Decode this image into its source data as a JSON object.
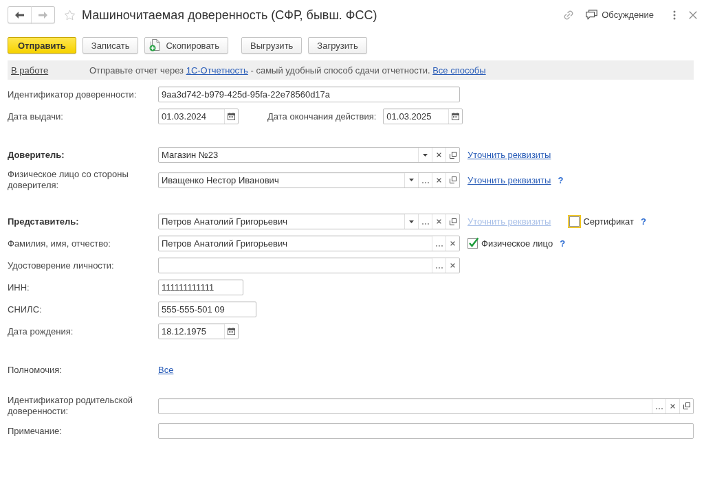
{
  "header": {
    "navigation": {
      "back": {
        "disabled": false
      },
      "forward": {
        "disabled": true
      }
    },
    "favorite": false,
    "title": "Машиночитаемая доверенность (СФР, бывш. ФСС)",
    "discussion": "Обсуждение"
  },
  "toolbar": {
    "groups": [
      [
        {
          "kind": "primary",
          "label": "Отправить"
        },
        {
          "kind": "plain",
          "label": "Записать"
        },
        {
          "kind": "copy",
          "label": "Скопировать"
        }
      ],
      [
        {
          "kind": "plain",
          "label": "Выгрузить"
        },
        {
          "kind": "plain",
          "label": "Загрузить"
        }
      ]
    ]
  },
  "info_bar": {
    "status": "В работе",
    "message": [
      {
        "kind": "text",
        "text": "Отправьте отчет через "
      },
      {
        "kind": "link",
        "text": "1С-Отчетность"
      },
      {
        "kind": "text",
        "text": " - самый удобный способ сдачи отчетности. "
      },
      {
        "kind": "link",
        "text": "Все способы"
      }
    ]
  },
  "form": {
    "sections": [
      {
        "rows": [
          {
            "kind": "text",
            "label": "Идентификатор доверенности:",
            "label_bold": false,
            "value": "9aa3d742-b979-425d-95fa-22e78560d17a"
          },
          {
            "kind": "date_range",
            "label": "Дата выдачи:",
            "label_bold": false,
            "value": "01.03.2024",
            "end_label": "Дата окончания действия:",
            "end_value": "01.03.2025"
          }
        ]
      },
      {
        "rows": [
          {
            "kind": "reference",
            "label": "Доверитель:",
            "label_bold": true,
            "value": "Магазин №23",
            "buttons": [
              {
                "kind": "dropdown"
              },
              {
                "kind": "clear"
              },
              {
                "kind": "open"
              }
            ],
            "link": {
              "text": "Уточнить реквизиты",
              "disabled": false
            }
          },
          {
            "kind": "reference",
            "label": "Физическое лицо со стороны доверителя:",
            "label_bold": false,
            "value": "Иващенко Нестор Иванович",
            "buttons": [
              {
                "kind": "dropdown"
              },
              {
                "kind": "select"
              },
              {
                "kind": "clear"
              },
              {
                "kind": "open"
              }
            ],
            "link": {
              "text": "Уточнить реквизиты",
              "disabled": false
            },
            "help": "?"
          }
        ]
      },
      {
        "rows": [
          {
            "kind": "reference",
            "label": "Представитель:",
            "label_bold": true,
            "value": "Петров Анатолий Григорьевич",
            "buttons": [
              {
                "kind": "dropdown"
              },
              {
                "kind": "select"
              },
              {
                "kind": "clear"
              },
              {
                "kind": "open"
              }
            ],
            "link": {
              "text": "Уточнить реквизиты",
              "disabled": true
            },
            "checkbox": {
              "label": "Сертификат",
              "checked": false,
              "focused": true
            },
            "help": "?"
          },
          {
            "kind": "reference",
            "label": "Фамилия, имя, отчество:",
            "label_bold": false,
            "value": "Петров Анатолий Григорьевич",
            "buttons": [
              {
                "kind": "select"
              },
              {
                "kind": "clear"
              }
            ],
            "checkbox": {
              "label": "Физическое лицо",
              "checked": true,
              "focused": false
            },
            "help": "?"
          },
          {
            "kind": "reference",
            "label": "Удостоверение личности:",
            "label_bold": false,
            "buttons": [
              {
                "kind": "select"
              },
              {
                "kind": "clear"
              }
            ]
          },
          {
            "kind": "short_text",
            "label": "ИНН:",
            "label_bold": false,
            "value": "111111111111"
          },
          {
            "kind": "short_text",
            "label": "СНИЛС:",
            "label_bold": false,
            "value": "555-555-501 09"
          },
          {
            "kind": "date",
            "label": "Дата рождения:",
            "label_bold": false,
            "value": "18.12.1975"
          }
        ]
      },
      {
        "rows": [
          {
            "kind": "link",
            "label": "Полномочия:",
            "label_bold": false,
            "value": "Все"
          }
        ]
      },
      {
        "rows": [
          {
            "kind": "long_reference",
            "label": "Идентификатор родительской доверенности:",
            "label_bold": false,
            "buttons": [
              {
                "kind": "select"
              },
              {
                "kind": "clear"
              },
              {
                "kind": "open"
              }
            ]
          },
          {
            "kind": "long_text",
            "label": "Примечание:",
            "label_bold": false
          }
        ]
      }
    ]
  }
}
